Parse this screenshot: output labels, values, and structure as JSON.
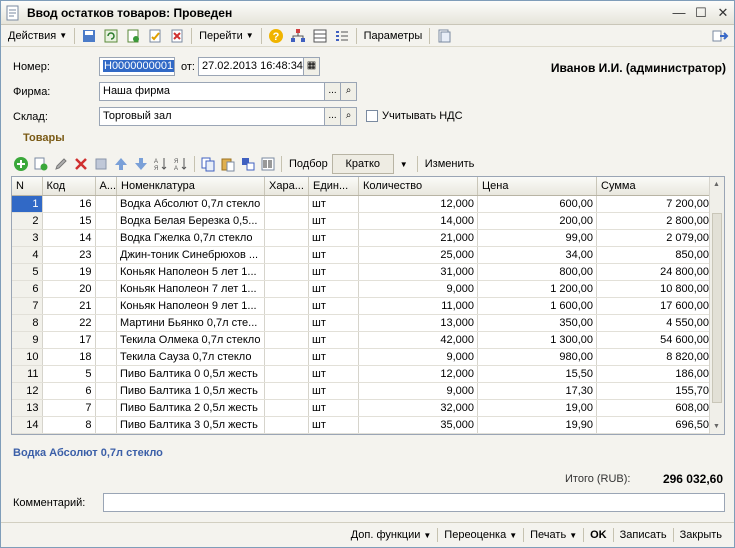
{
  "window": {
    "title": "Ввод остатков товаров: Проведен"
  },
  "toolbar": {
    "actions_label": "Действия",
    "goto_label": "Перейти",
    "params_label": "Параметры"
  },
  "header": {
    "number_label": "Номер:",
    "number_value": "Н0000000001",
    "date_label": "от:",
    "date_value": "27.02.2013 16:48:34",
    "user": "Иванов И.И. (администратор)",
    "firm_label": "Фирма:",
    "firm_value": "Наша фирма",
    "warehouse_label": "Склад:",
    "warehouse_value": "Торговый зал",
    "vat_label": "Учитывать НДС"
  },
  "goods": {
    "section_title": "Товары",
    "select_label": "Подбор",
    "brief_label": "Кратко",
    "change_label": "Изменить",
    "columns": [
      "N",
      "Код",
      "А...",
      "Номенклатура",
      "Хара...",
      "Един...",
      "Количество",
      "Цена",
      "Сумма"
    ],
    "rows": [
      {
        "n": "1",
        "code": "16",
        "a": "",
        "name": "Водка Абсолют 0,7л стекло",
        "char": "",
        "unit": "шт",
        "qty": "12,000",
        "price": "600,00",
        "sum": "7 200,00"
      },
      {
        "n": "2",
        "code": "15",
        "a": "",
        "name": "Водка Белая Березка 0,5...",
        "char": "",
        "unit": "шт",
        "qty": "14,000",
        "price": "200,00",
        "sum": "2 800,00"
      },
      {
        "n": "3",
        "code": "14",
        "a": "",
        "name": "Водка Гжелка 0,7л стекло",
        "char": "",
        "unit": "шт",
        "qty": "21,000",
        "price": "99,00",
        "sum": "2 079,00"
      },
      {
        "n": "4",
        "code": "23",
        "a": "",
        "name": "Джин-тоник Синебрюхов ...",
        "char": "",
        "unit": "шт",
        "qty": "25,000",
        "price": "34,00",
        "sum": "850,00"
      },
      {
        "n": "5",
        "code": "19",
        "a": "",
        "name": "Коньяк Наполеон 5 лет 1...",
        "char": "",
        "unit": "шт",
        "qty": "31,000",
        "price": "800,00",
        "sum": "24 800,00"
      },
      {
        "n": "6",
        "code": "20",
        "a": "",
        "name": "Коньяк Наполеон 7 лет 1...",
        "char": "",
        "unit": "шт",
        "qty": "9,000",
        "price": "1 200,00",
        "sum": "10 800,00"
      },
      {
        "n": "7",
        "code": "21",
        "a": "",
        "name": "Коньяк Наполеон 9 лет 1...",
        "char": "",
        "unit": "шт",
        "qty": "11,000",
        "price": "1 600,00",
        "sum": "17 600,00"
      },
      {
        "n": "8",
        "code": "22",
        "a": "",
        "name": "Мартини Бьянко 0,7л сте...",
        "char": "",
        "unit": "шт",
        "qty": "13,000",
        "price": "350,00",
        "sum": "4 550,00"
      },
      {
        "n": "9",
        "code": "17",
        "a": "",
        "name": "Текила Олмека 0,7л стекло",
        "char": "",
        "unit": "шт",
        "qty": "42,000",
        "price": "1 300,00",
        "sum": "54 600,00"
      },
      {
        "n": "10",
        "code": "18",
        "a": "",
        "name": "Текила Сауза 0,7л стекло",
        "char": "",
        "unit": "шт",
        "qty": "9,000",
        "price": "980,00",
        "sum": "8 820,00"
      },
      {
        "n": "11",
        "code": "5",
        "a": "",
        "name": "Пиво Балтика 0 0,5л жесть",
        "char": "",
        "unit": "шт",
        "qty": "12,000",
        "price": "15,50",
        "sum": "186,00"
      },
      {
        "n": "12",
        "code": "6",
        "a": "",
        "name": "Пиво Балтика 1 0,5л жесть",
        "char": "",
        "unit": "шт",
        "qty": "9,000",
        "price": "17,30",
        "sum": "155,70"
      },
      {
        "n": "13",
        "code": "7",
        "a": "",
        "name": "Пиво Балтика 2 0,5л жесть",
        "char": "",
        "unit": "шт",
        "qty": "32,000",
        "price": "19,00",
        "sum": "608,00"
      },
      {
        "n": "14",
        "code": "8",
        "a": "",
        "name": "Пиво Балтика 3 0,5л жесть",
        "char": "",
        "unit": "шт",
        "qty": "35,000",
        "price": "19,90",
        "sum": "696,50"
      }
    ],
    "current_item": "Водка Абсолют 0,7л стекло"
  },
  "totals": {
    "label": "Итого (RUB):",
    "value": "296 032,60"
  },
  "comment": {
    "label": "Комментарий:",
    "value": ""
  },
  "footer": {
    "extra_label": "Доп. функции",
    "reprice_label": "Переоценка",
    "print_label": "Печать",
    "ok_label": "OK",
    "save_label": "Записать",
    "close_label": "Закрыть"
  }
}
